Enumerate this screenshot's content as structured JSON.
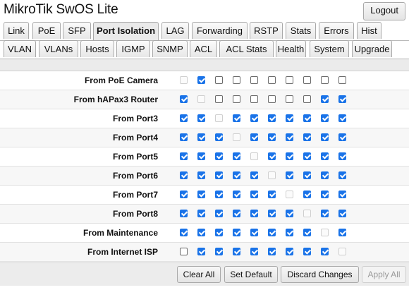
{
  "app": {
    "title": "MikroTik SwOS Lite",
    "logout_label": "Logout"
  },
  "tabs_row1": [
    "Link",
    "PoE",
    "SFP",
    "Port Isolation",
    "LAG",
    "Forwarding",
    "RSTP",
    "Stats",
    "Errors",
    "Hist"
  ],
  "tabs_row2": [
    "VLAN",
    "VLANs",
    "Hosts",
    "IGMP",
    "SNMP",
    "ACL",
    "ACL Stats",
    "Health",
    "System",
    "Upgrade"
  ],
  "active_tab": "Port Isolation",
  "isolation": {
    "rows": [
      {
        "label": "From PoE Camera",
        "states": [
          "dis",
          "on",
          "off",
          "off",
          "off",
          "off",
          "off",
          "off",
          "off",
          "off"
        ]
      },
      {
        "label": "From hAPax3 Router",
        "states": [
          "on",
          "dis",
          "off",
          "off",
          "off",
          "off",
          "off",
          "off",
          "on",
          "on"
        ]
      },
      {
        "label": "From Port3",
        "states": [
          "on",
          "on",
          "dis",
          "on",
          "on",
          "on",
          "on",
          "on",
          "on",
          "on"
        ]
      },
      {
        "label": "From Port4",
        "states": [
          "on",
          "on",
          "on",
          "dis",
          "on",
          "on",
          "on",
          "on",
          "on",
          "on"
        ]
      },
      {
        "label": "From Port5",
        "states": [
          "on",
          "on",
          "on",
          "on",
          "dis",
          "on",
          "on",
          "on",
          "on",
          "on"
        ]
      },
      {
        "label": "From Port6",
        "states": [
          "on",
          "on",
          "on",
          "on",
          "on",
          "dis",
          "on",
          "on",
          "on",
          "on"
        ]
      },
      {
        "label": "From Port7",
        "states": [
          "on",
          "on",
          "on",
          "on",
          "on",
          "on",
          "dis",
          "on",
          "on",
          "on"
        ]
      },
      {
        "label": "From Port8",
        "states": [
          "on",
          "on",
          "on",
          "on",
          "on",
          "on",
          "on",
          "dis",
          "on",
          "on"
        ]
      },
      {
        "label": "From Maintenance",
        "states": [
          "on",
          "on",
          "on",
          "on",
          "on",
          "on",
          "on",
          "on",
          "dis",
          "on"
        ]
      },
      {
        "label": "From Internet ISP",
        "states": [
          "off",
          "on",
          "on",
          "on",
          "on",
          "on",
          "on",
          "on",
          "on",
          "dis"
        ]
      }
    ]
  },
  "footer": {
    "clear_all": "Clear All",
    "set_default": "Set Default",
    "discard_changes": "Discard Changes",
    "apply_all": "Apply All"
  },
  "colors": {
    "checked": "#1a73e8",
    "unchecked_border": "#6b6b6b",
    "disabled_border": "#cfcfcf"
  }
}
